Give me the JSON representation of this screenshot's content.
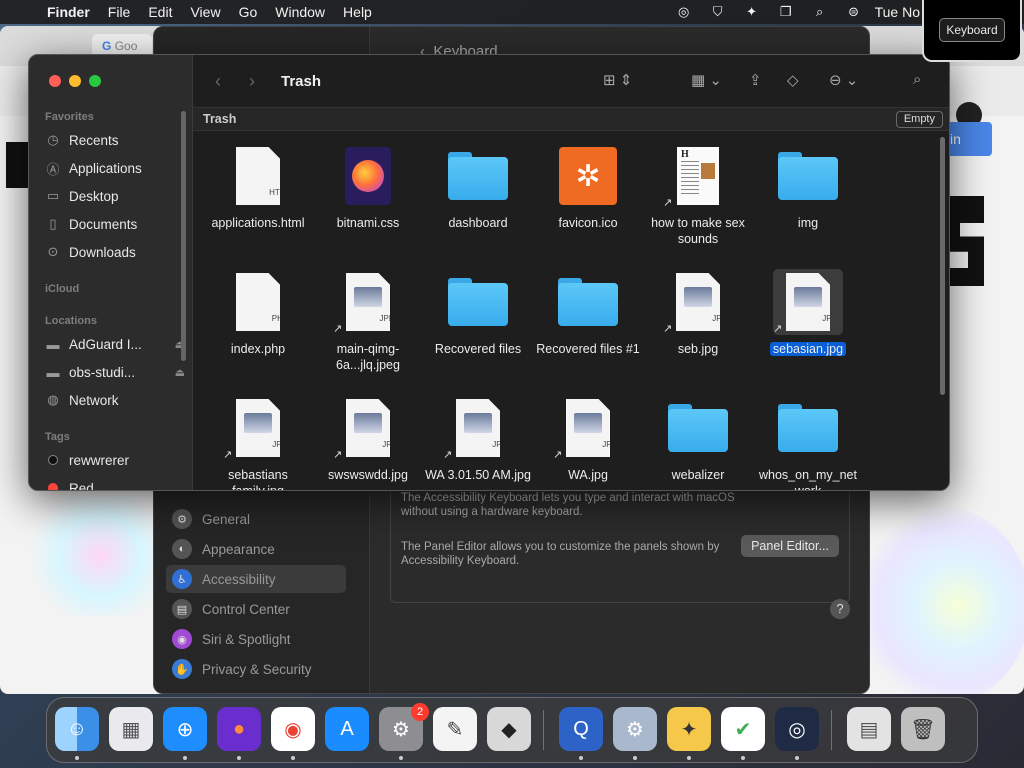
{
  "menubar": {
    "app": "Finder",
    "items": [
      "File",
      "Edit",
      "View",
      "Go",
      "Window",
      "Help"
    ],
    "clock": "Tue No"
  },
  "tooltip": {
    "label": "Keyboard"
  },
  "browser": {
    "tab_label": "Goo",
    "signin_label": "in"
  },
  "settings": {
    "title": "Keyboard",
    "sidebar": [
      "General",
      "Appearance",
      "Accessibility",
      "Control Center",
      "Siri & Spotlight",
      "Privacy & Security"
    ],
    "active": "Accessibility",
    "para1": "The Accessibility Keyboard lets you type and interact with macOS without using a hardware keyboard.",
    "para2": "The Panel Editor allows you to customize the panels shown by Accessibility Keyboard.",
    "panel_button": "Panel Editor...",
    "help": "?"
  },
  "finder": {
    "title": "Trash",
    "path_label": "Trash",
    "empty_button": "Empty",
    "sidebar": {
      "favorites_header": "Favorites",
      "favorites": [
        "Recents",
        "Applications",
        "Desktop",
        "Documents",
        "Downloads"
      ],
      "icloud_header": "iCloud",
      "locations_header": "Locations",
      "locations": [
        "AdGuard I...",
        "obs-studi...",
        "Network"
      ],
      "tags_header": "Tags",
      "tags": [
        "rewwrerer",
        "Red"
      ]
    },
    "files": [
      {
        "name": "applications.html",
        "kind": "doc",
        "ext": "HTML"
      },
      {
        "name": "bitnami.css",
        "kind": "firefox"
      },
      {
        "name": "dashboard",
        "kind": "folder"
      },
      {
        "name": "favicon.ico",
        "kind": "xampp"
      },
      {
        "name": "how to make sex sounds",
        "kind": "article"
      },
      {
        "name": "img",
        "kind": "folder"
      },
      {
        "name": "index.php",
        "kind": "doc",
        "ext": "PHP"
      },
      {
        "name": "main-qimg-6a...jlq.jpeg",
        "kind": "jpg",
        "ext": "JPEG"
      },
      {
        "name": "Recovered files",
        "kind": "folder"
      },
      {
        "name": "Recovered files #1",
        "kind": "folder"
      },
      {
        "name": "seb.jpg",
        "kind": "jpg",
        "ext": "JPG"
      },
      {
        "name": "sebasian.jpg",
        "kind": "jpg",
        "ext": "JPG",
        "selected": true
      },
      {
        "name": "sebastians familv.jpg",
        "kind": "jpg",
        "ext": "JPG"
      },
      {
        "name": "swswswdd.jpg",
        "kind": "jpg",
        "ext": "JPG"
      },
      {
        "name": "WA 3.01.50 AM.jpg",
        "kind": "jpg",
        "ext": "JPG"
      },
      {
        "name": "WA.jpg",
        "kind": "jpg",
        "ext": "JPG"
      },
      {
        "name": "webalizer",
        "kind": "folder"
      },
      {
        "name": "whos_on_my_net work",
        "kind": "folder"
      }
    ]
  },
  "dock": {
    "apps": [
      "Finder",
      "Launchpad",
      "Safari",
      "Firefox",
      "Chrome",
      "App Store",
      "System Settings",
      "TextEdit",
      "Roblox",
      "QuickTime",
      "Settings Gear",
      "Cyberduck",
      "AdGuard",
      "OBS",
      "Documents Stack",
      "Trash"
    ],
    "settings_badge": "2"
  }
}
